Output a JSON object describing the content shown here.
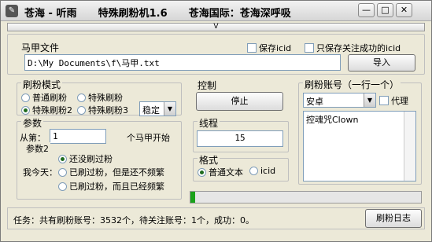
{
  "window": {
    "title": "苍海 - 听雨      特殊刷粉机1.6      苍海国际：苍海深呼吸",
    "minimize_glyph": "—",
    "restore_glyph": "□",
    "close_glyph": "✕"
  },
  "collapse_glyph": "V",
  "file": {
    "label": "马甲文件",
    "path": "D:\\My Documents\\f\\马甲.txt",
    "save_icid_label": "保存icid",
    "save_success_label": "只保存关注成功的icid",
    "import_label": "导入"
  },
  "mode": {
    "label": "刷粉模式",
    "options": [
      "普通刷粉",
      "特殊刷粉",
      "特殊刷粉2",
      "特殊刷粉3"
    ],
    "selected": "特殊刷粉2",
    "stability_value": "稳定"
  },
  "params": {
    "label": "参数",
    "from_label": "从第：",
    "from_value": "1",
    "from_suffix": "个马甲开始",
    "params2_label": "参数2",
    "today_label": "我今天：",
    "today_options": [
      "还没刷过粉",
      "已刷过粉，但是还不频繁",
      "已刷过粉，而且已经频繁"
    ],
    "today_selected": "还没刷过粉"
  },
  "control": {
    "label": "控制",
    "stop_label": "停止",
    "threads_label": "线程",
    "threads_value": "15",
    "format_label": "格式",
    "format_options": [
      "普通文本",
      "icid"
    ],
    "format_selected": "普通文本"
  },
  "accounts": {
    "label": "刷粉账号（一行一个）",
    "platform_value": "安卓",
    "proxy_label": "代理",
    "list_text": "控魂咒Clown"
  },
  "progress": {
    "percent": 2
  },
  "status": {
    "text": "任务：共有刷粉账号：3532个，待关注账号：1个，成功：0。",
    "log_label": "刷粉日志"
  }
}
